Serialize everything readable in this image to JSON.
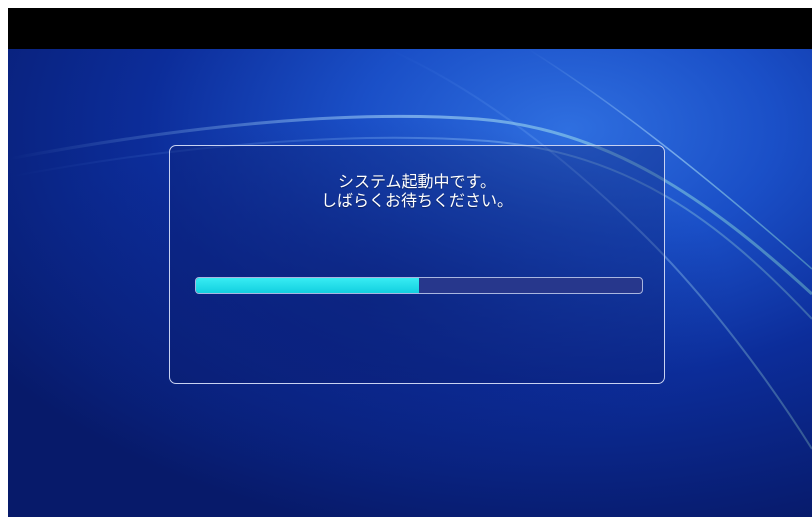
{
  "boot_screen": {
    "message_line1": "システム起動中です。",
    "message_line2": "しばらくお待ちください。",
    "progress": 0.5
  },
  "colors": {
    "top_bar": "#000000",
    "background": "#0b2a8f",
    "dialog_border": "#c8d2f2",
    "progress_fill": "#12cfe0",
    "progress_track": "#27378c"
  }
}
